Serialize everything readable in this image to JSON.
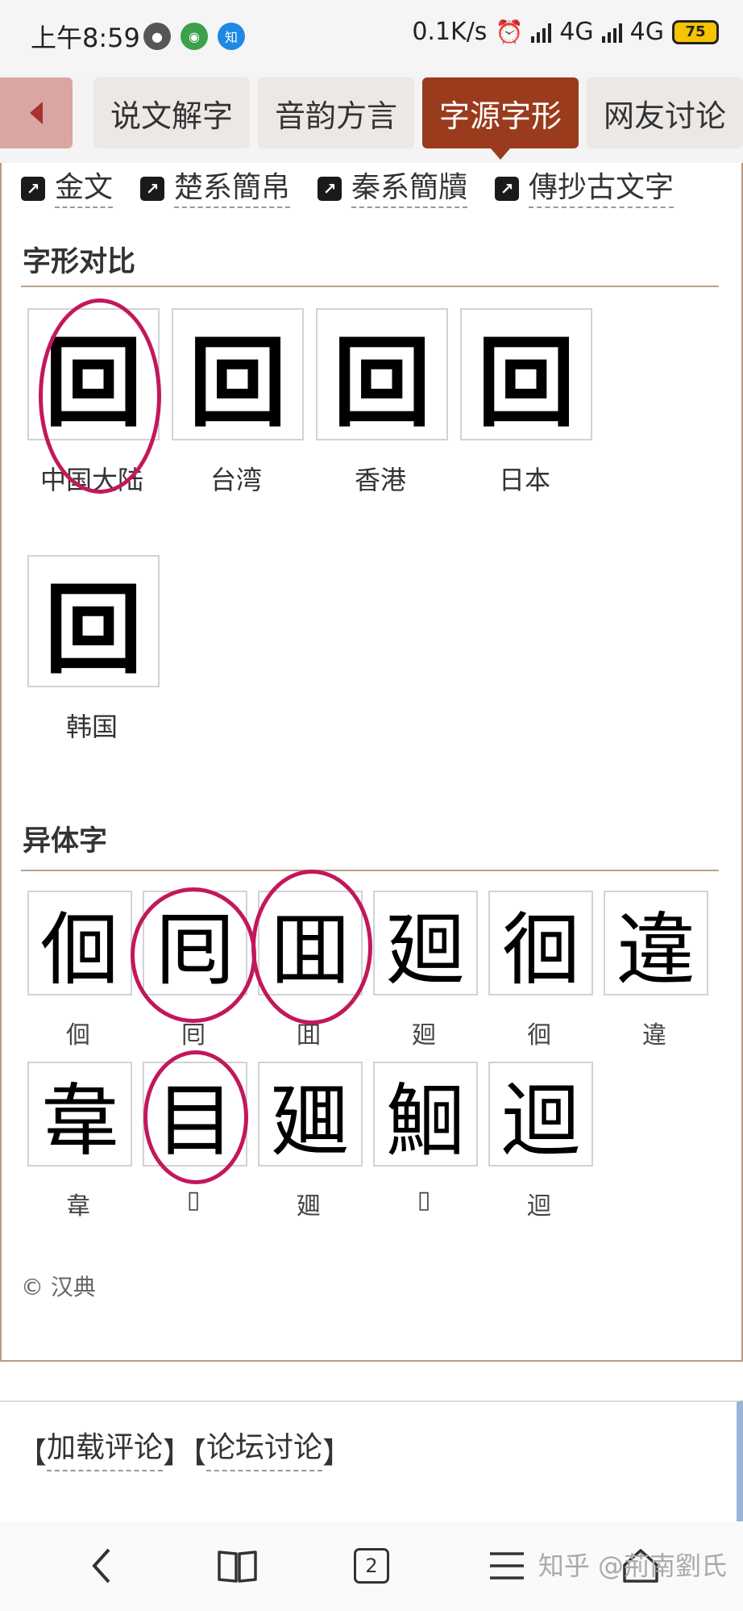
{
  "status_bar": {
    "time": "上午8:59",
    "speed": "0.1K/s",
    "network1": "4G",
    "network2": "4G",
    "battery": "75",
    "app_badge": "知"
  },
  "tabs": [
    "说文解字",
    "音韵方言",
    "字源字形",
    "网友讨论"
  ],
  "active_tab": "字源字形",
  "external_links": [
    "金文",
    "楚系簡帛",
    "秦系簡牘",
    "傳抄古文字"
  ],
  "glyph_compare": {
    "title": "字形对比",
    "items": [
      {
        "glyph": "回",
        "label": "中国大陆"
      },
      {
        "glyph": "回",
        "label": "台湾"
      },
      {
        "glyph": "回",
        "label": "香港"
      },
      {
        "glyph": "回",
        "label": "日本"
      },
      {
        "glyph": "回",
        "label": "韩国"
      }
    ]
  },
  "variants": {
    "title": "异体字",
    "row1": [
      {
        "glyph": "佪",
        "label": "佪"
      },
      {
        "glyph": "囘",
        "label": "囘"
      },
      {
        "glyph": "囬",
        "label": "囬"
      },
      {
        "glyph": "廻",
        "label": "廻"
      },
      {
        "glyph": "徊",
        "label": "徊"
      },
      {
        "glyph": "違",
        "label": "違"
      }
    ],
    "row2": [
      {
        "glyph": "韋",
        "label": "韋"
      },
      {
        "glyph": "目",
        "label": "▯"
      },
      {
        "glyph": "廽",
        "label": "廽"
      },
      {
        "glyph": "鮰",
        "label": "▯"
      },
      {
        "glyph": "迴",
        "label": "迴"
      }
    ]
  },
  "copyright": "© 汉典",
  "comments": {
    "load_comments": "加载评论",
    "forum": "论坛讨论"
  },
  "bottom_nav": {
    "tab_count": "2"
  },
  "watermark": "知乎 @荊南劉氏",
  "colors": {
    "active_tab": "#9a3b1d",
    "highlight_circle": "#c2185b",
    "panel_border": "#b79b86"
  }
}
